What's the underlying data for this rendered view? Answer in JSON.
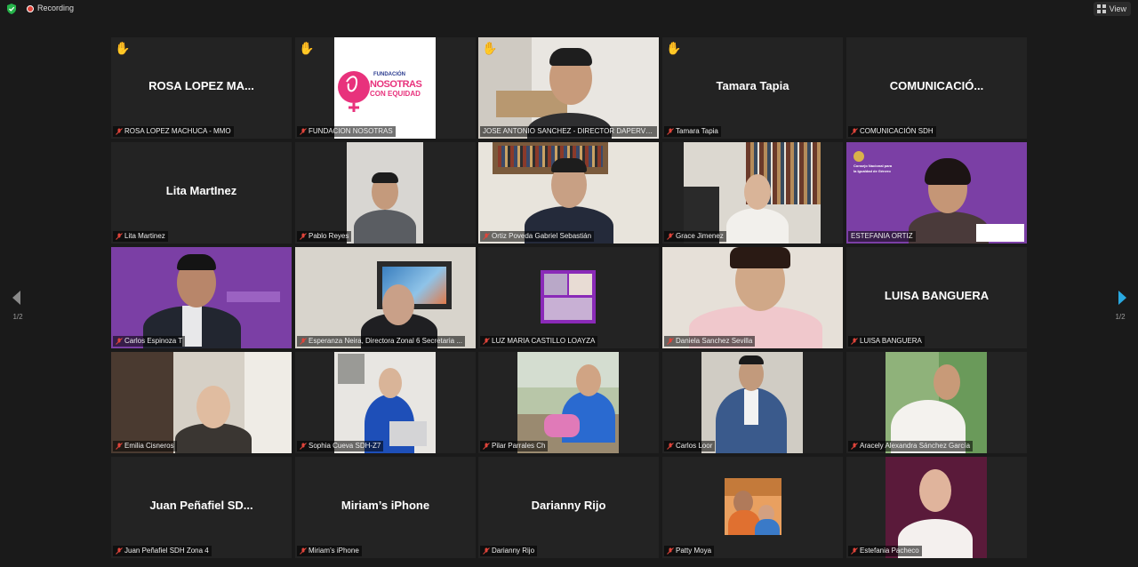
{
  "topbar": {
    "recording_label": "Recording",
    "view_label": "View"
  },
  "pagination": {
    "left": "1/2",
    "right": "1/2"
  },
  "tiles": [
    {
      "display_name": "ROSA LOPEZ MA...",
      "label": "ROSA LOPEZ MACHUCA - MMO"
    },
    {
      "display_name": "",
      "label": "FUNDACION NOSOTRAS"
    },
    {
      "display_name": "",
      "label": "JOSE ANTONIO SANCHEZ - DIRECTOR DAPERVVE..."
    },
    {
      "display_name": "Tamara Tapia",
      "label": "Tamara Tapia"
    },
    {
      "display_name": "COMUNICACIÓ...",
      "label": "COMUNICACIÓN SDH"
    },
    {
      "display_name": "Lita MartInez",
      "label": "Lita Martinez"
    },
    {
      "display_name": "",
      "label": "Pablo Reyes"
    },
    {
      "display_name": "",
      "label": "Ortiz Poveda Gabriel Sebastián"
    },
    {
      "display_name": "",
      "label": "Grace Jimenez"
    },
    {
      "display_name": "",
      "label": "ESTEFANIA ORTIZ"
    },
    {
      "display_name": "",
      "label": "Carlos Espinoza T"
    },
    {
      "display_name": "",
      "label": "Esperanza Neira, Directora Zonal 6 Secretaria ..."
    },
    {
      "display_name": "",
      "label": "LUZ MARIA CASTILLO LOAYZA"
    },
    {
      "display_name": "",
      "label": "Daniela Sanchez Sevilla"
    },
    {
      "display_name": "LUISA BANGUERA",
      "label": "LUISA BANGUERA"
    },
    {
      "display_name": "",
      "label": "Emilia Cisneros"
    },
    {
      "display_name": "",
      "label": "Sophia Cueva SDH-Z7"
    },
    {
      "display_name": "",
      "label": "Pilar Parrales Ch"
    },
    {
      "display_name": "",
      "label": "Carlos Loor"
    },
    {
      "display_name": "",
      "label": "Aracely Alexandra Sánchez García"
    },
    {
      "display_name": "Juan Peñafiel SD...",
      "label": "Juan Peñafiel SDH Zona 4"
    },
    {
      "display_name": "Miriam’s iPhone",
      "label": "Miriam’s iPhone"
    },
    {
      "display_name": "Darianny Rijo",
      "label": "Darianny Rijo"
    },
    {
      "display_name": "",
      "label": "Patty Moya"
    },
    {
      "display_name": "",
      "label": "Estefania Pacheco"
    }
  ],
  "logo": {
    "line1": "FUNDACIÓN",
    "line2": "NOSOTRAS",
    "line3": "CON EQUIDAD"
  },
  "slide": {
    "line1": "Consejo Nacional para",
    "line2": "la Igualdad de Género"
  },
  "colors": {
    "active_border": "#c6d548",
    "hand": "#f2b63d",
    "accent_purple": "#7b3fa5",
    "nav_arrow": "#29a8e0"
  }
}
